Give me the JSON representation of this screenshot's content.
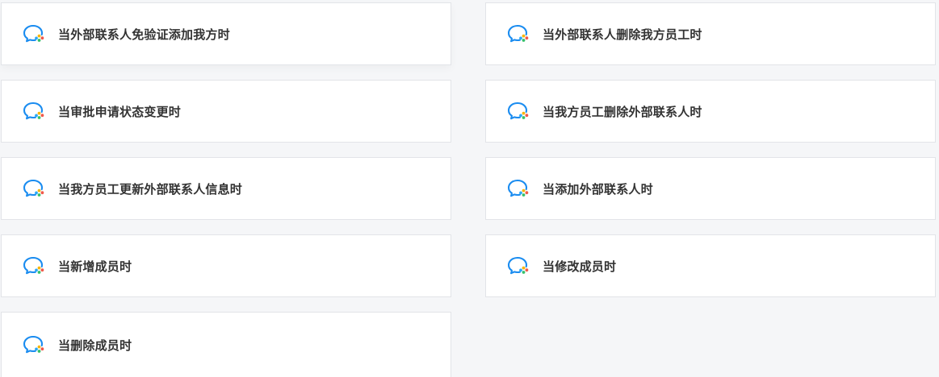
{
  "events": [
    {
      "label": "当外部联系人免验证添加我方时",
      "icon": "wecom-chat-icon"
    },
    {
      "label": "当外部联系人删除我方员工时",
      "icon": "wecom-chat-icon"
    },
    {
      "label": "当审批申请状态变更时",
      "icon": "wecom-chat-icon"
    },
    {
      "label": "当我方员工删除外部联系人时",
      "icon": "wecom-chat-icon"
    },
    {
      "label": "当我方员工更新外部联系人信息时",
      "icon": "wecom-chat-icon"
    },
    {
      "label": "当添加外部联系人时",
      "icon": "wecom-chat-icon"
    },
    {
      "label": "当新增成员时",
      "icon": "wecom-chat-icon"
    },
    {
      "label": "当修改成员时",
      "icon": "wecom-chat-icon"
    },
    {
      "label": "当删除成员时",
      "icon": "wecom-chat-icon"
    }
  ],
  "colors": {
    "background": "#f5f6f8",
    "card": "#ffffff",
    "border": "#e2e4e8",
    "text": "#333333",
    "icon_blue": "#1a8cf0",
    "icon_yellow": "#f8b500",
    "icon_red": "#f05a4a",
    "icon_green": "#37c06a",
    "icon_lightblue": "#2ca8f5"
  }
}
